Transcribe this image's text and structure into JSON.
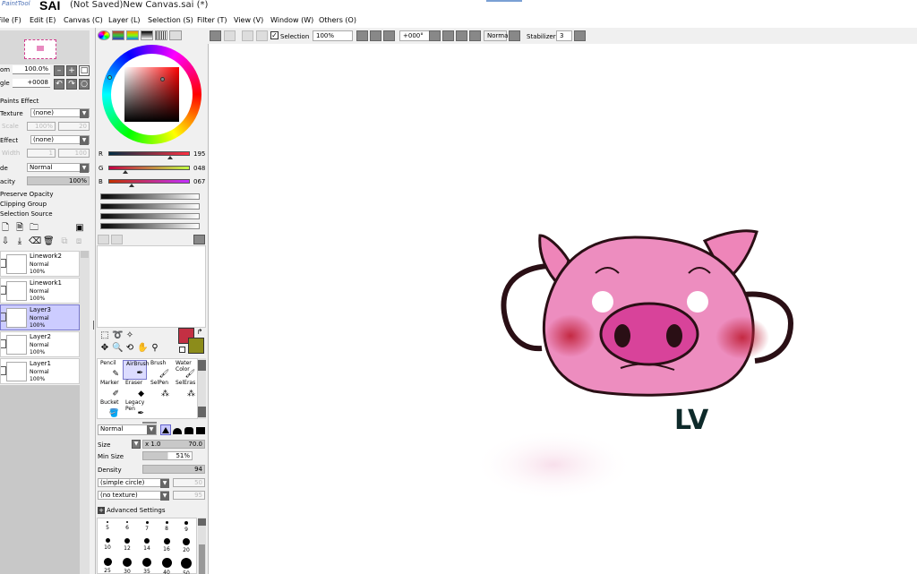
{
  "titlebar": {
    "logo": "PaintTool",
    "app": "SAI",
    "doc": "(Not Saved)New Canvas.sai (*)"
  },
  "menu": [
    {
      "label": "File (F)"
    },
    {
      "label": "Edit (E)"
    },
    {
      "label": "Canvas (C)"
    },
    {
      "label": "Layer (L)"
    },
    {
      "label": "Selection (S)"
    },
    {
      "label": "Filter (T)"
    },
    {
      "label": "View (V)"
    },
    {
      "label": "Window (W)"
    },
    {
      "label": "Others (O)"
    }
  ],
  "navigator": {
    "zoom_label": "om",
    "zoom_value": "100.0%",
    "angle_label": "gle",
    "angle_value": "+0008"
  },
  "paint_effect": {
    "title": "Paints Effect",
    "texture_label": "Texture",
    "texture_value": "(none)",
    "scale_label": "Scale",
    "scale_value": "100%",
    "scale_value2": "20",
    "effect_label": "Effect",
    "effect_value": "(none)",
    "width_label": "Width",
    "width_value": "1",
    "width_value2": "100"
  },
  "layer_props": {
    "mode_label": "de",
    "mode_value": "Normal",
    "opacity_label": "acity",
    "opacity_value": "100%",
    "preserve_opacity": "Preserve Opacity",
    "clipping_group": "Clipping Group",
    "selection_source": "Selection Source"
  },
  "layers": [
    {
      "name": "Linework2",
      "mode": "Normal",
      "opacity": "100%"
    },
    {
      "name": "Linework1",
      "mode": "Normal",
      "opacity": "100%"
    },
    {
      "name": "Layer3",
      "mode": "Normal",
      "opacity": "100%"
    },
    {
      "name": "Layer2",
      "mode": "Normal",
      "opacity": "100%"
    },
    {
      "name": "Layer1",
      "mode": "Normal",
      "opacity": "100%"
    }
  ],
  "color": {
    "r_label": "R",
    "r_value": "195",
    "g_label": "G",
    "g_value": "048",
    "b_label": "B",
    "b_value": "067",
    "primary": "#c33043",
    "secondary": "#8c8c1a"
  },
  "tools": [
    {
      "label": "Pencil"
    },
    {
      "label": "AirBrush"
    },
    {
      "label": "Brush"
    },
    {
      "label": "Water Color"
    },
    {
      "label": "Marker"
    },
    {
      "label": "Eraser"
    },
    {
      "label": "SelPen"
    },
    {
      "label": "SelEras"
    },
    {
      "label": "Bucket"
    },
    {
      "label": "Legacy Pen"
    }
  ],
  "brush_settings": {
    "blend_mode": "Normal",
    "size_label": "Size",
    "size_mult": "x 1.0",
    "size_value": "70.0",
    "minsize_label": "Min Size",
    "minsize_value": "51%",
    "density_label": "Density",
    "density_value": "94",
    "shape_value": "(simple circle)",
    "shape_num": "50",
    "texture_value": "(no texture)",
    "texture_num": "95",
    "advanced": "Advanced Settings"
  },
  "brush_sizes": [
    "5",
    "6",
    "7",
    "8",
    "9",
    "10",
    "12",
    "14",
    "16",
    "20",
    "25",
    "30",
    "35",
    "40",
    "50"
  ],
  "toolbar": {
    "selection_label": "Selection",
    "zoom_value": "100%",
    "angle_value": "+000°",
    "blend_value": "Normal",
    "stabilizer_label": "Stabilizer",
    "stabilizer_value": "3"
  },
  "canvas": {
    "signature": "LV"
  }
}
